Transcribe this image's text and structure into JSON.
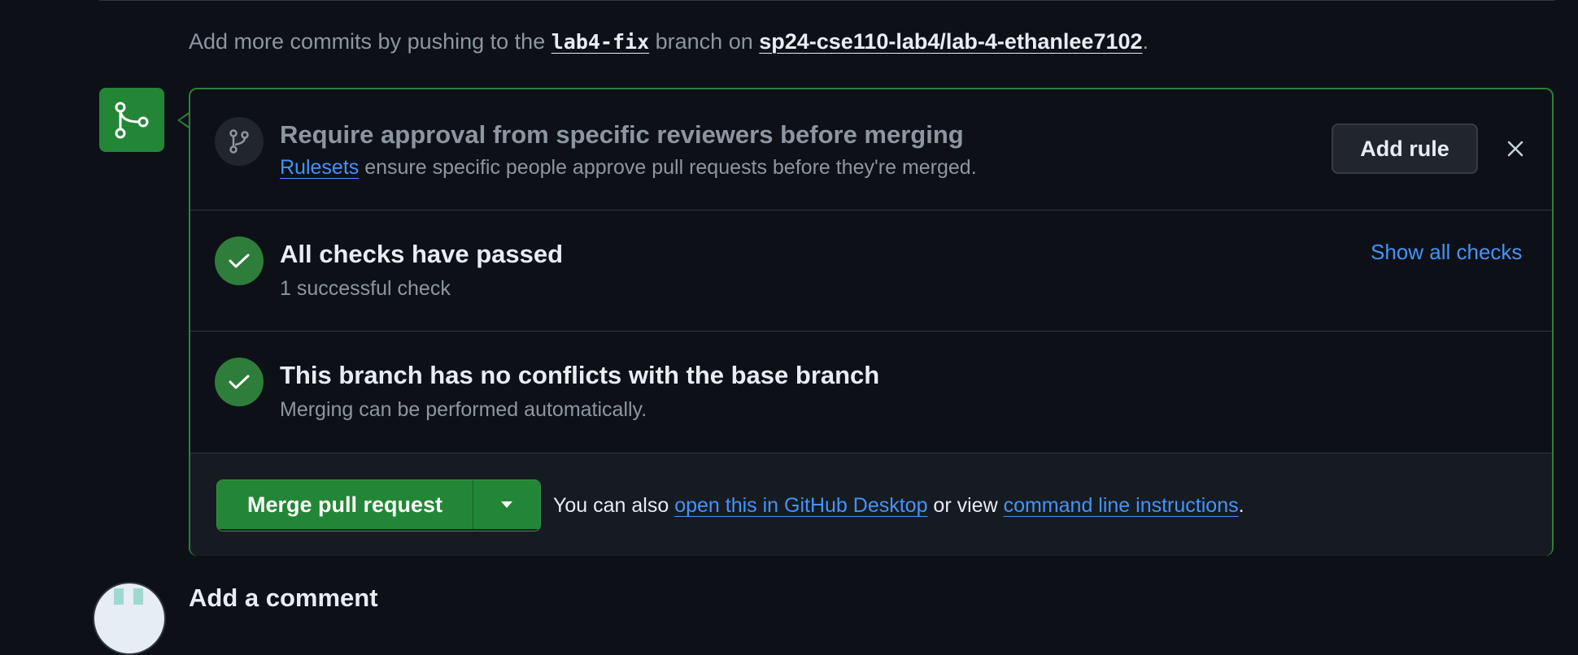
{
  "push_info": {
    "prefix": "Add more commits by pushing to the ",
    "branch": "lab4-fix",
    "middle": " branch on ",
    "repo": "sp24-cse110-lab4/lab-4-ethanlee7102",
    "suffix": "."
  },
  "ruleset": {
    "icon": "git-branch-icon",
    "title": "Require approval from specific reviewers before merging",
    "link_text": "Rulesets",
    "description": " ensure specific people approve pull requests before they're merged.",
    "add_rule_label": "Add rule",
    "close_icon": "close-icon"
  },
  "checks": {
    "icon": "check-icon",
    "title": "All checks have passed",
    "subtitle": "1 successful check",
    "show_all_label": "Show all checks"
  },
  "conflicts": {
    "icon": "check-icon",
    "title": "This branch has no conflicts with the base branch",
    "subtitle": "Merging can be performed automatically."
  },
  "merge": {
    "button_label": "Merge pull request",
    "dropdown_icon": "triangle-down-icon",
    "note_prefix": "You can also ",
    "desktop_link": "open this in GitHub Desktop",
    "note_middle": " or view ",
    "cli_link": "command line instructions",
    "note_suffix": "."
  },
  "comment_heading": "Add a comment",
  "colors": {
    "background": "#0d1117",
    "accent_green": "#238636",
    "link_blue": "#4493f8",
    "muted_text": "#8d96a0",
    "border": "#30363d"
  }
}
